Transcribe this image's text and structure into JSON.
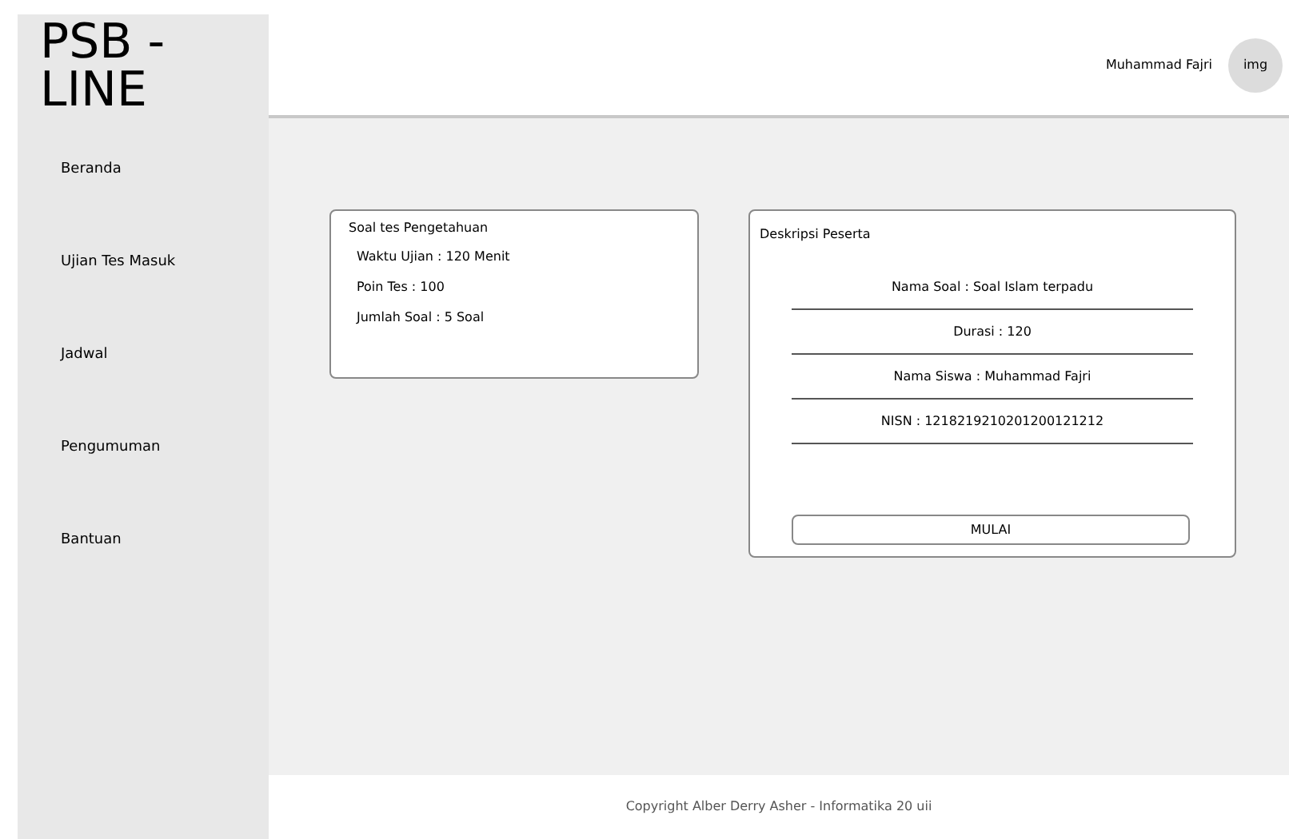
{
  "logo": "PSB - LINE",
  "user": {
    "name": "Muhammad Fajri",
    "avatar": "img"
  },
  "sidebar": {
    "items": [
      "Beranda",
      "Ujian Tes Masuk",
      "Jadwal",
      "Pengumuman",
      "Bantuan"
    ]
  },
  "test_card": {
    "title": "Soal tes Pengetahuan",
    "lines": [
      "Waktu Ujian : 120 Menit",
      "Poin Tes : 100",
      "Jumlah Soal : 5 Soal"
    ]
  },
  "participant_card": {
    "title": "Deskripsi Peserta",
    "fields": [
      "Nama Soal : Soal Islam terpadu",
      "Durasi : 120",
      "Nama Siswa : Muhammad Fajri",
      "NISN : 1218219210201200121212"
    ],
    "button": "MULAI"
  },
  "footer": "Copyright Alber Derry Asher - Informatika 20 uii"
}
